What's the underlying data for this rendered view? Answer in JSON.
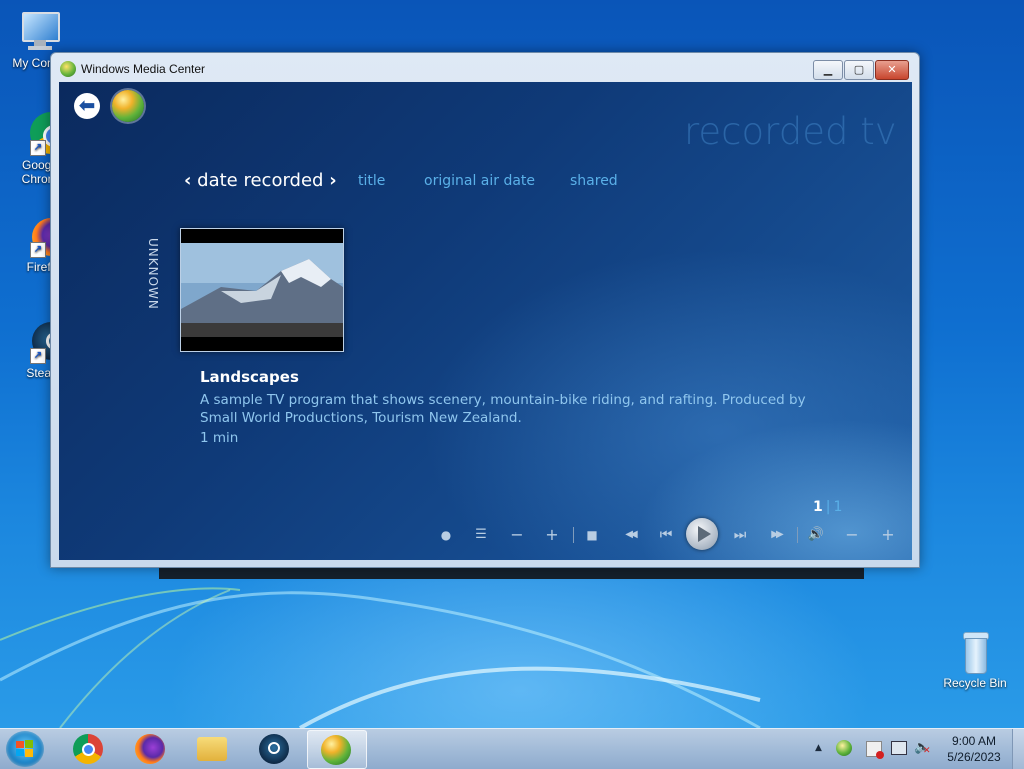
{
  "desktop": {
    "icons": [
      {
        "label": "My Comp",
        "icon": "computer-icon"
      },
      {
        "label": "Googl Chron",
        "icon": "chrome-icon"
      },
      {
        "label": "Firefo",
        "icon": "firefox-icon"
      },
      {
        "label": "Stean",
        "icon": "steam-icon"
      }
    ],
    "recycle_bin": {
      "label": "Recycle Bin",
      "icon": "recycle-bin-icon"
    }
  },
  "window": {
    "title": "Windows Media Center",
    "buttons": {
      "minimize": "▁",
      "maximize": "▢",
      "close": "✕"
    }
  },
  "media_center": {
    "page_title": "recorded tv",
    "back_symbol": "⬅",
    "sort_options": [
      {
        "label": "date recorded",
        "active": true
      },
      {
        "label": "title",
        "active": false
      },
      {
        "label": "original air date",
        "active": false
      },
      {
        "label": "shared",
        "active": false
      }
    ],
    "sort_prev": "‹",
    "sort_next": "›",
    "group_label": "UNKNOWN",
    "program": {
      "name": "Landscapes",
      "description": "A sample TV program that shows scenery, mountain-bike riding, and rafting. Produced by Small World Productions, Tourism New Zealand.",
      "duration": "1 min"
    },
    "pager": {
      "current": "1",
      "separator": "|",
      "total": "1"
    },
    "controls": {
      "record": "●",
      "guide": "☰",
      "channel_down": "−",
      "channel_up": "+",
      "stop": "■",
      "rewind": "◀◀",
      "skip_back": "⏮",
      "skip_forward": "⏭",
      "fast_forward": "▶▶",
      "volume_mute": "🔊",
      "volume_down": "−",
      "volume_up": "+"
    }
  },
  "taskbar": {
    "apps": [
      {
        "name": "chrome",
        "active": false
      },
      {
        "name": "firefox",
        "active": false
      },
      {
        "name": "file-explorer",
        "active": false
      },
      {
        "name": "steam",
        "active": false
      },
      {
        "name": "windows-media-center",
        "active": true
      }
    ],
    "tray": {
      "expand": "▲"
    },
    "clock": {
      "time": "9:00 AM",
      "date": "5/26/2023"
    }
  },
  "colors": {
    "accent": "#5ab0e8",
    "mc_background": "#0f3a78",
    "taskbar": "#a5bdd9"
  }
}
